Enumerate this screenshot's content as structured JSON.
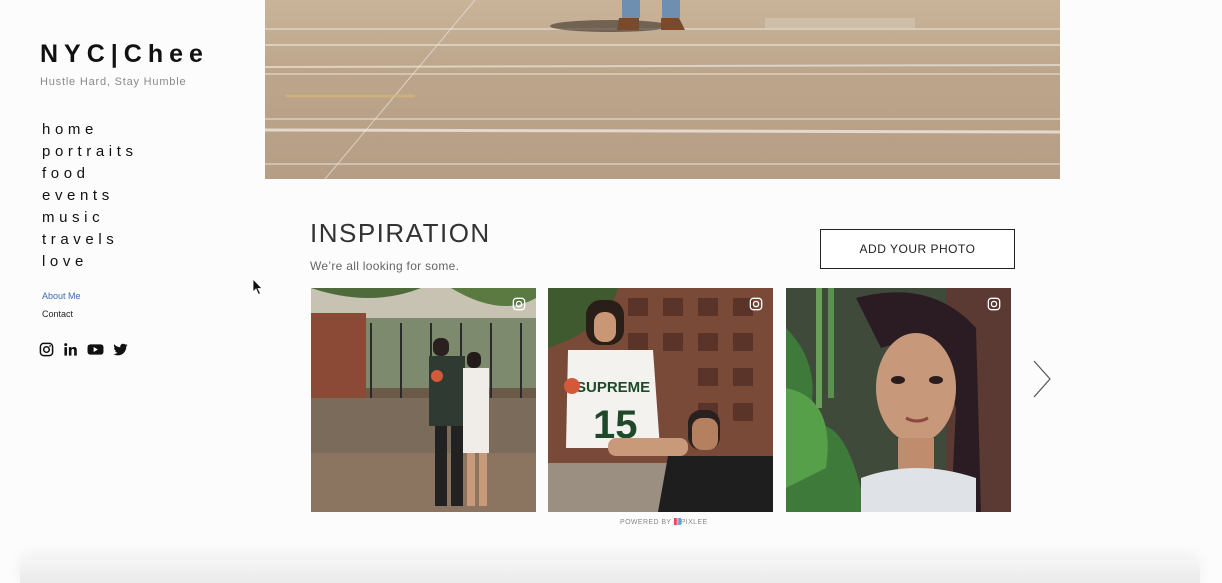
{
  "site": {
    "logo": "NYC|Chee",
    "tagline": "Hustle Hard, Stay Humble"
  },
  "nav": {
    "items": [
      {
        "label": "home"
      },
      {
        "label": "portraits"
      },
      {
        "label": "food"
      },
      {
        "label": "events"
      },
      {
        "label": "music"
      },
      {
        "label": "travels"
      },
      {
        "label": "love"
      }
    ],
    "about_label": "About Me",
    "contact_label": "Contact"
  },
  "social": {
    "icons": [
      "instagram-icon",
      "linkedin-icon",
      "youtube-icon",
      "twitter-icon"
    ]
  },
  "inspiration": {
    "title": "INSPIRATION",
    "subtitle": "We’re all looking for some.",
    "add_button_label": "ADD YOUR PHOTO",
    "powered_prefix": "POWERED BY",
    "powered_brand": "PIXLEE"
  },
  "colors": {
    "link_accent": "#3a6ab5",
    "text_dark": "#111111",
    "background": "#fcfcfc"
  }
}
